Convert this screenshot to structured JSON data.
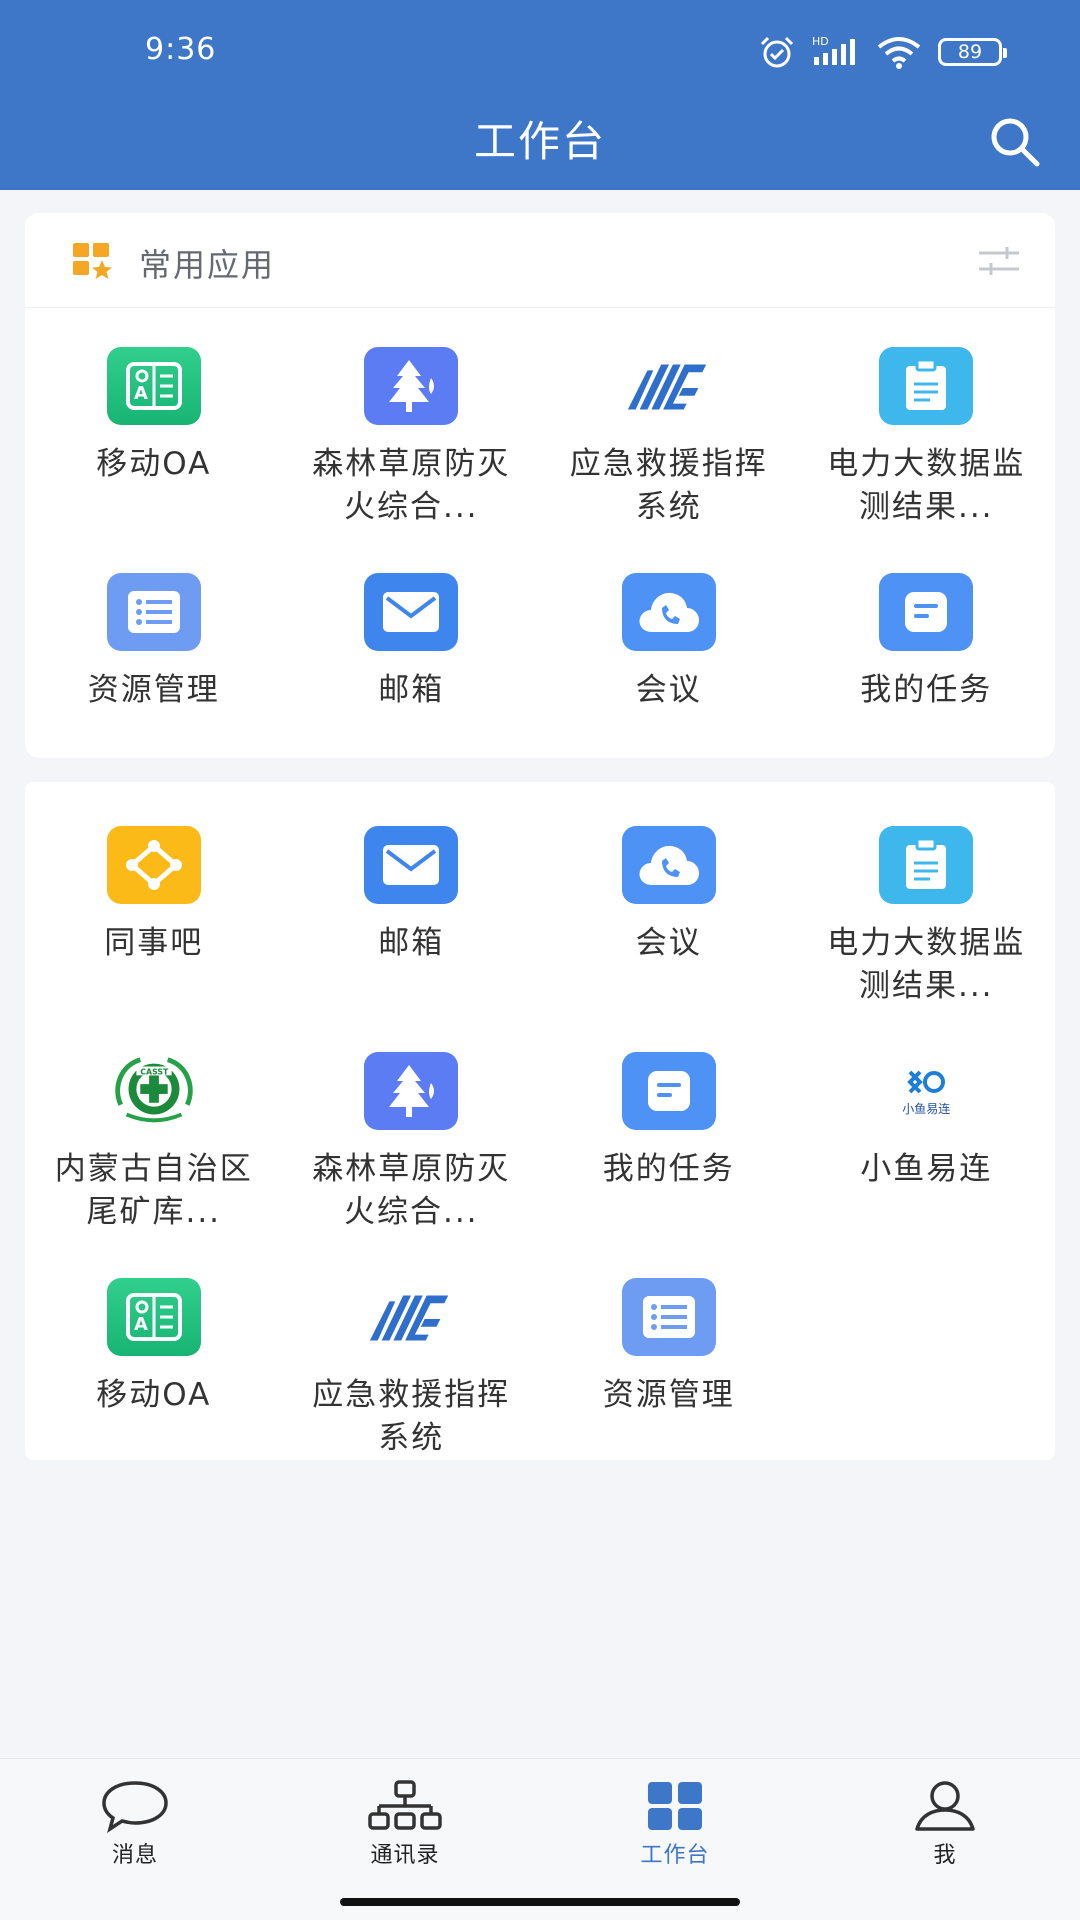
{
  "status": {
    "time": "9:36",
    "battery": "89",
    "network": "HD"
  },
  "header": {
    "title": "工作台"
  },
  "common": {
    "title": "常用应用",
    "apps": [
      {
        "label": "移动OA",
        "icon": "oa-icon",
        "color": "ic-green"
      },
      {
        "label": "森林草原防灭火综合...",
        "icon": "forest-fire-icon",
        "color": "ic-indigo"
      },
      {
        "label": "应急救援指挥系统",
        "icon": "emergency-logo-icon",
        "color": "ic-none"
      },
      {
        "label": "电力大数据监测结果...",
        "icon": "clipboard-icon",
        "color": "ic-cyan"
      },
      {
        "label": "资源管理",
        "icon": "list-icon",
        "color": "ic-lightblue"
      },
      {
        "label": "邮箱",
        "icon": "mail-icon",
        "color": "ic-blue"
      },
      {
        "label": "会议",
        "icon": "cloud-phone-icon",
        "color": "ic-sky"
      },
      {
        "label": "我的任务",
        "icon": "task-icon",
        "color": "ic-sky"
      }
    ]
  },
  "all": {
    "apps": [
      {
        "label": "同事吧",
        "icon": "colleague-icon",
        "color": "ic-yellow"
      },
      {
        "label": "邮箱",
        "icon": "mail-icon",
        "color": "ic-blue"
      },
      {
        "label": "会议",
        "icon": "cloud-phone-icon",
        "color": "ic-sky"
      },
      {
        "label": "电力大数据监测结果...",
        "icon": "clipboard-icon",
        "color": "ic-cyan"
      },
      {
        "label": "内蒙古自治区尾矿库...",
        "icon": "casst-logo-icon",
        "color": "ic-none"
      },
      {
        "label": "森林草原防灭火综合...",
        "icon": "forest-fire-icon",
        "color": "ic-indigo"
      },
      {
        "label": "我的任务",
        "icon": "task-icon",
        "color": "ic-sky"
      },
      {
        "label": "小鱼易连",
        "icon": "xiaoyu-logo-icon",
        "color": "ic-none",
        "logo_text": "小鱼易连"
      },
      {
        "label": "移动OA",
        "icon": "oa-icon",
        "color": "ic-green"
      },
      {
        "label": "应急救援指挥系统",
        "icon": "emergency-logo-icon",
        "color": "ic-none"
      },
      {
        "label": "资源管理",
        "icon": "list-icon",
        "color": "ic-lightblue"
      }
    ]
  },
  "nav": [
    {
      "label": "消息",
      "icon": "chat-bubble-icon",
      "active": false
    },
    {
      "label": "通讯录",
      "icon": "org-chart-icon",
      "active": false
    },
    {
      "label": "工作台",
      "icon": "grid-icon",
      "active": true
    },
    {
      "label": "我",
      "icon": "person-icon",
      "active": false
    }
  ],
  "colors": {
    "primary": "#3E77C7",
    "background": "#F3F5F8",
    "accent_orange": "#F5A623"
  }
}
